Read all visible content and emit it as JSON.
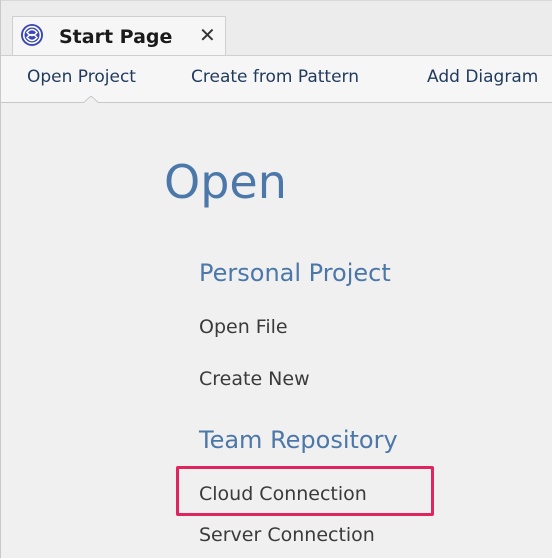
{
  "tab": {
    "title": "Start Page",
    "close_glyph": "✕",
    "icon": "ea-logo-icon"
  },
  "nav": {
    "items": [
      "Open Project",
      "Create from Pattern",
      "Add Diagram"
    ],
    "active_index": 0
  },
  "main": {
    "heading": "Open",
    "sections": [
      {
        "title": "Personal Project",
        "links": [
          "Open File",
          "Create New"
        ]
      },
      {
        "title": "Team Repository",
        "links": [
          "Cloud Connection",
          "Server Connection"
        ]
      }
    ],
    "highlighted_link": "Cloud Connection"
  },
  "colors": {
    "heading": "#4c77a9",
    "nav_text": "#1f3a5c",
    "highlight": "#e0245e",
    "icon": "#3b47b8"
  }
}
